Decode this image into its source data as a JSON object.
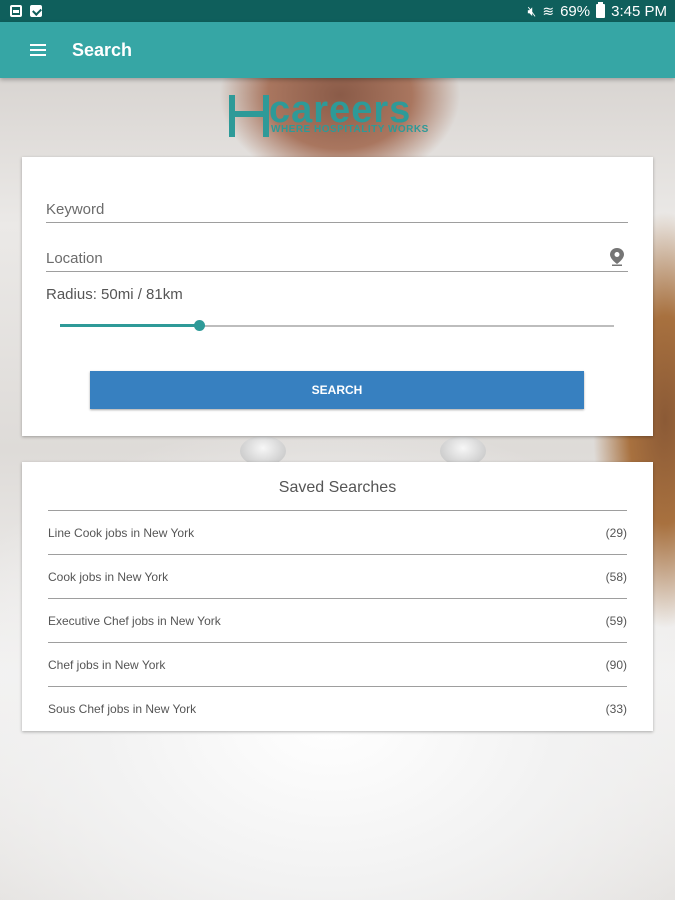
{
  "status_bar": {
    "battery": "69%",
    "time": "3:45 PM"
  },
  "app_bar": {
    "title": "Search"
  },
  "logo": {
    "word": "careers",
    "tagline": "WHERE HOSPITALITY WORKS"
  },
  "search": {
    "keyword_placeholder": "Keyword",
    "location_placeholder": "Location",
    "radius_label": "Radius: 50mi / 81km",
    "radius_fraction": 0.25,
    "button_label": "SEARCH"
  },
  "saved_searches": {
    "title": "Saved Searches",
    "items": [
      {
        "label": "Line Cook jobs in New York",
        "count": "(29)"
      },
      {
        "label": "Cook jobs in New York",
        "count": "(58)"
      },
      {
        "label": "Executive Chef jobs in New York",
        "count": "(59)"
      },
      {
        "label": "Chef jobs in New York",
        "count": "(90)"
      },
      {
        "label": "Sous Chef jobs in New York",
        "count": "(33)"
      }
    ]
  },
  "colors": {
    "status_bar": "#0f5f5c",
    "app_bar": "#36a6a5",
    "accent": "#2e9a98",
    "button": "#3780c0"
  }
}
